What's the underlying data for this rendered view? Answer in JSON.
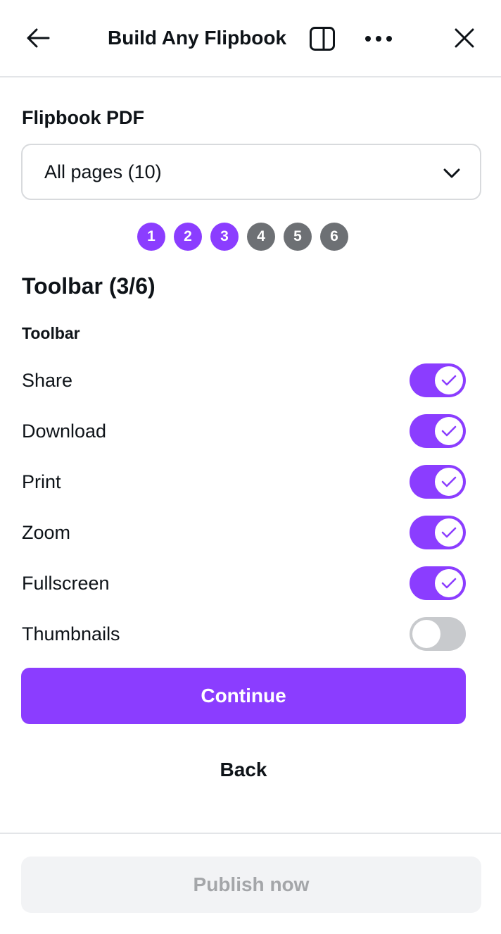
{
  "header": {
    "title": "Build Any Flipbook",
    "icons": [
      "arrow-left-icon",
      "side-panel-icon",
      "more-icon",
      "close-icon"
    ]
  },
  "pdf_section": {
    "label": "Flipbook PDF",
    "select_value": "All pages (10)"
  },
  "steps": {
    "items": [
      "1",
      "2",
      "3",
      "4",
      "5",
      "6"
    ],
    "completed": 3,
    "active_color": "#8b3dff",
    "inactive_color": "#6d7074"
  },
  "step_title": "Toolbar (3/6)",
  "toolbar": {
    "heading": "Toolbar",
    "items": [
      {
        "label": "Share",
        "enabled": true
      },
      {
        "label": "Download",
        "enabled": true
      },
      {
        "label": "Print",
        "enabled": true
      },
      {
        "label": "Zoom",
        "enabled": true
      },
      {
        "label": "Fullscreen",
        "enabled": true
      },
      {
        "label": "Thumbnails",
        "enabled": false
      }
    ]
  },
  "actions": {
    "continue_label": "Continue",
    "back_label": "Back",
    "publish_label": "Publish now"
  },
  "colors": {
    "accent": "#8b3dff",
    "toggle_off": "#c8cacd",
    "disabled_bg": "#f2f3f5"
  }
}
